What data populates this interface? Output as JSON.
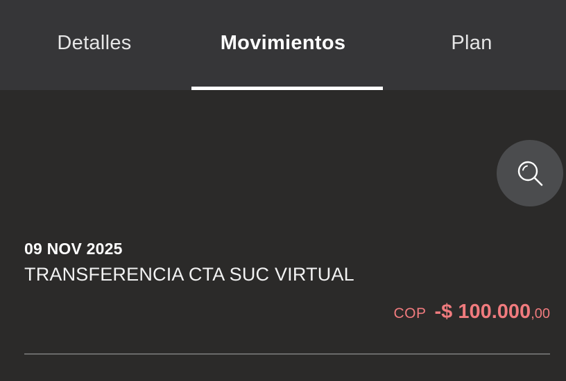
{
  "tabs": [
    {
      "label": "Detalles",
      "active": false
    },
    {
      "label": "Movimientos",
      "active": true
    },
    {
      "label": "Plan",
      "active": false
    }
  ],
  "search": {
    "icon": "search-icon"
  },
  "transactions": [
    {
      "date": "09 NOV 2025",
      "description": "TRANSFERENCIA CTA SUC VIRTUAL",
      "currency": "COP",
      "amount_integer": "-$ 100.000",
      "amount_decimal": ",00"
    }
  ],
  "colors": {
    "background": "#2b2a29",
    "tabbar": "#363638",
    "debit_amount": "#f07b7e",
    "search_button": "#4b4c4e",
    "divider": "#6b6b6b"
  }
}
